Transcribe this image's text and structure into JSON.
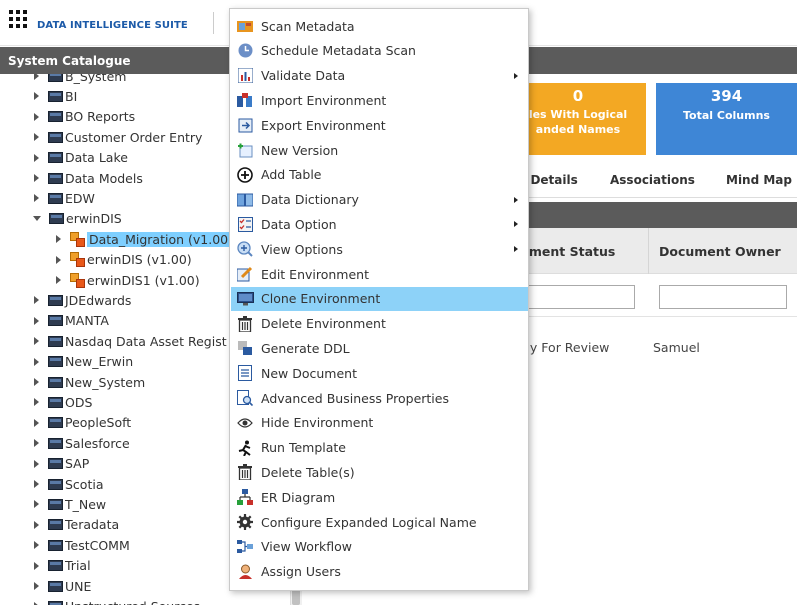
{
  "app": {
    "brand": "DATA INTELLIGENCE SUITE"
  },
  "left_panel": {
    "title": "System Catalogue",
    "tree": [
      {
        "label": "B_System",
        "level": 0,
        "state": "collapsed",
        "icon": "database-icon"
      },
      {
        "label": "BI",
        "level": 0,
        "state": "collapsed",
        "icon": "database-icon"
      },
      {
        "label": "BO Reports",
        "level": 0,
        "state": "collapsed",
        "icon": "database-icon"
      },
      {
        "label": "Customer Order Entry",
        "level": 0,
        "state": "collapsed",
        "icon": "database-icon"
      },
      {
        "label": "Data Lake",
        "level": 0,
        "state": "collapsed",
        "icon": "database-icon"
      },
      {
        "label": "Data Models",
        "level": 0,
        "state": "collapsed",
        "icon": "database-icon"
      },
      {
        "label": "EDW",
        "level": 0,
        "state": "collapsed",
        "icon": "database-icon"
      },
      {
        "label": "erwinDIS",
        "level": 0,
        "state": "expanded",
        "icon": "database-icon"
      },
      {
        "label": "Data_Migration (v1.00)",
        "level": 1,
        "state": "collapsed",
        "icon": "environment-icon",
        "selected": true
      },
      {
        "label": "erwinDIS (v1.00)",
        "level": 1,
        "state": "collapsed",
        "icon": "environment-icon"
      },
      {
        "label": "erwinDIS1 (v1.00)",
        "level": 1,
        "state": "collapsed",
        "icon": "environment-icon"
      },
      {
        "label": "JDEdwards",
        "level": 0,
        "state": "collapsed",
        "icon": "database-icon"
      },
      {
        "label": "MANTA",
        "level": 0,
        "state": "collapsed",
        "icon": "database-icon"
      },
      {
        "label": "Nasdaq Data Asset Regist",
        "level": 0,
        "state": "collapsed",
        "icon": "database-icon"
      },
      {
        "label": "New_Erwin",
        "level": 0,
        "state": "collapsed",
        "icon": "database-icon"
      },
      {
        "label": "New_System",
        "level": 0,
        "state": "collapsed",
        "icon": "database-icon"
      },
      {
        "label": "ODS",
        "level": 0,
        "state": "collapsed",
        "icon": "database-icon"
      },
      {
        "label": "PeopleSoft",
        "level": 0,
        "state": "collapsed",
        "icon": "database-icon"
      },
      {
        "label": "Salesforce",
        "level": 0,
        "state": "collapsed",
        "icon": "database-icon"
      },
      {
        "label": "SAP",
        "level": 0,
        "state": "collapsed",
        "icon": "database-icon"
      },
      {
        "label": "Scotia",
        "level": 0,
        "state": "collapsed",
        "icon": "database-icon"
      },
      {
        "label": "T_New",
        "level": 0,
        "state": "collapsed",
        "icon": "database-icon"
      },
      {
        "label": "Teradata",
        "level": 0,
        "state": "collapsed",
        "icon": "database-icon"
      },
      {
        "label": "TestCOMM",
        "level": 0,
        "state": "collapsed",
        "icon": "database-icon"
      },
      {
        "label": "Trial",
        "level": 0,
        "state": "collapsed",
        "icon": "database-icon"
      },
      {
        "label": "UNE",
        "level": 0,
        "state": "collapsed",
        "icon": "database-icon"
      },
      {
        "label": "Unstructured Sources",
        "level": 0,
        "state": "collapsed",
        "icon": "database-icon"
      }
    ]
  },
  "summary_cards": [
    {
      "value": "0",
      "label_line1": "les With Logical",
      "label_line2": "anded Names",
      "color": "#f3a823"
    },
    {
      "value": "394",
      "label": "Total Columns",
      "color": "#3e86d6"
    }
  ],
  "tabs": [
    "nt Details",
    "Associations",
    "Mind Map"
  ],
  "table": {
    "headers": [
      "ument Status",
      "Document Owner"
    ],
    "rows": [
      [
        "dy For Review",
        "Samuel"
      ]
    ]
  },
  "context_menu": {
    "items": [
      {
        "label": "Scan Metadata",
        "icon": "scan-metadata-icon",
        "submenu": false
      },
      {
        "label": "Schedule Metadata Scan",
        "icon": "clock-icon",
        "submenu": false
      },
      {
        "label": "Validate Data",
        "icon": "bar-chart-icon",
        "submenu": true
      },
      {
        "label": "Import Environment",
        "icon": "import-icon",
        "submenu": false
      },
      {
        "label": "Export Environment",
        "icon": "export-icon",
        "submenu": false
      },
      {
        "label": "New Version",
        "icon": "new-version-icon",
        "submenu": false
      },
      {
        "label": "Add Table",
        "icon": "plus-circle-icon",
        "submenu": false
      },
      {
        "label": "Data Dictionary",
        "icon": "book-icon",
        "submenu": true
      },
      {
        "label": "Data Option",
        "icon": "checklist-icon",
        "submenu": true
      },
      {
        "label": "View Options",
        "icon": "magnify-plus-icon",
        "submenu": true
      },
      {
        "label": "Edit Environment",
        "icon": "edit-icon",
        "submenu": false
      },
      {
        "label": "Clone Environment",
        "icon": "monitor-icon",
        "submenu": false,
        "active": true
      },
      {
        "label": "Delete Environment",
        "icon": "trash-icon",
        "submenu": false
      },
      {
        "label": "Generate DDL",
        "icon": "ddl-icon",
        "submenu": false
      },
      {
        "label": "New Document",
        "icon": "document-icon",
        "submenu": false
      },
      {
        "label": "Advanced Business Properties",
        "icon": "search-document-icon",
        "submenu": false
      },
      {
        "label": "Hide Environment",
        "icon": "eye-icon",
        "submenu": false
      },
      {
        "label": "Run Template",
        "icon": "running-icon",
        "submenu": false
      },
      {
        "label": "Delete Table(s)",
        "icon": "trash-icon",
        "submenu": false
      },
      {
        "label": "ER Diagram",
        "icon": "hierarchy-icon",
        "submenu": false
      },
      {
        "label": "Configure Expanded Logical Name",
        "icon": "gear-icon",
        "submenu": false
      },
      {
        "label": "View Workflow",
        "icon": "workflow-icon",
        "submenu": false
      },
      {
        "label": "Assign Users",
        "icon": "user-icon",
        "submenu": false
      }
    ]
  },
  "colors": {
    "header_bg": "#5b5b5b",
    "brand_blue": "#1c5aa8",
    "selection": "#7ecfff",
    "menu_active": "#8dd2f8"
  }
}
